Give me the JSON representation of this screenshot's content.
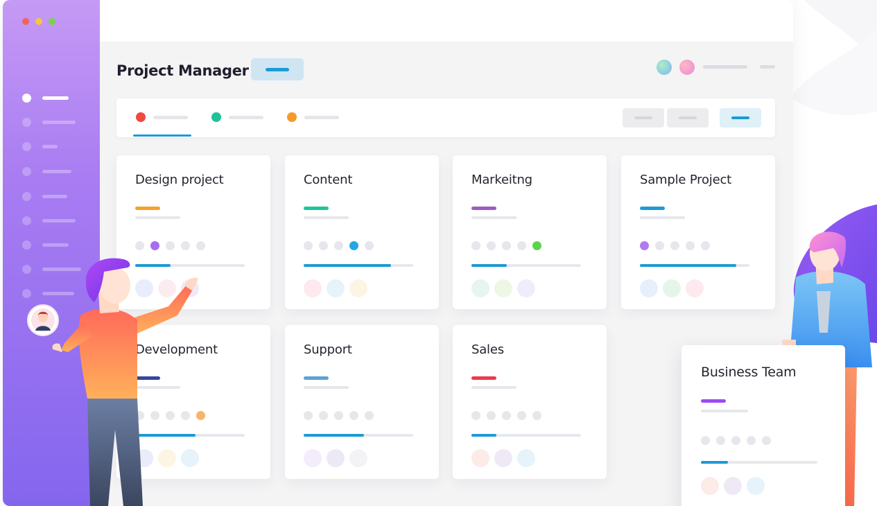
{
  "app": {
    "title": "Project Manager",
    "colors": {
      "sidebar_top": "#c59af5",
      "sidebar_bottom": "#8466ee",
      "accent_blue": "#1d9ad6",
      "main_bg": "#f4f4f5"
    }
  },
  "window_controls": [
    {
      "name": "close",
      "color": "#f2625b"
    },
    {
      "name": "minimize",
      "color": "#f6c53e"
    },
    {
      "name": "maximize",
      "color": "#7bd24a"
    }
  ],
  "sidebar": {
    "items": [
      {
        "id": "nav-1",
        "active": true
      },
      {
        "id": "nav-2",
        "active": false
      },
      {
        "id": "nav-3",
        "active": false
      },
      {
        "id": "nav-4",
        "active": false
      },
      {
        "id": "nav-5",
        "active": false
      },
      {
        "id": "nav-6",
        "active": false
      },
      {
        "id": "nav-7",
        "active": false
      },
      {
        "id": "nav-8",
        "active": false
      },
      {
        "id": "nav-9",
        "active": false
      }
    ]
  },
  "header": {
    "avatars": [
      {
        "color": "green-blue-gradient-icon"
      },
      {
        "color": "pink-gradient-icon"
      }
    ]
  },
  "tabs": [
    {
      "dot_color": "#f0493f",
      "selected": true
    },
    {
      "dot_color": "#1fc39b",
      "selected": false
    },
    {
      "dot_color": "#f79a2b",
      "selected": false
    }
  ],
  "toolbar": {
    "buttons": [
      "secondary",
      "secondary",
      "primary"
    ]
  },
  "cards": [
    {
      "title": "Design project",
      "accent": "#f5a12b",
      "highlight_dot": 1,
      "highlight_color": "#a66ef0",
      "progress": 0.32,
      "people": [
        "#e9ecfb",
        "#fdecef",
        "#f1e9fb"
      ]
    },
    {
      "title": "Content",
      "accent": "#1fc39b",
      "highlight_dot": 3,
      "highlight_color": "#25a7e5",
      "progress": 0.8,
      "people": [
        "#fde9ee",
        "#e6f3fb",
        "#fdf5e3"
      ]
    },
    {
      "title": "Markeitng",
      "accent": "#9b5cc0",
      "highlight_dot": 4,
      "highlight_color": "#5ad44e",
      "progress": 0.32,
      "people": [
        "#e6f6ee",
        "#eef7e6",
        "#f1ecfb"
      ]
    },
    {
      "title": "Sample Project",
      "accent": "#1d9ad6",
      "highlight_dot": 0,
      "highlight_color": "#b07af2",
      "progress": 0.88,
      "people": [
        "#e6f0fb",
        "#e5f5ea",
        "#fde9ee"
      ]
    },
    {
      "title": "Development",
      "accent": "#35479b",
      "highlight_dot": 4,
      "highlight_color": "#f6b46e",
      "progress": 0.55,
      "people": [
        "#e9ecfb",
        "#fdf5e3",
        "#e6f3fb"
      ]
    },
    {
      "title": "Support",
      "accent": "#5ba3d4",
      "highlight_dot": -1,
      "highlight_color": "",
      "progress": 0.55,
      "people": [
        "#f2ecfb",
        "#ede8f6",
        "#f3f3f5"
      ]
    },
    {
      "title": "Sales",
      "accent": "#ea3a4c",
      "highlight_dot": -1,
      "highlight_color": "",
      "progress": 0.23,
      "people": [
        "#fdebe8",
        "#efe9f6",
        "#e6f3fb"
      ]
    }
  ],
  "floating_card": {
    "title": "Business Team",
    "accent": "#9b4cf5",
    "progress": 0.23,
    "people": [
      "#fdebe8",
      "#efe9f6",
      "#e6f3fb"
    ]
  }
}
